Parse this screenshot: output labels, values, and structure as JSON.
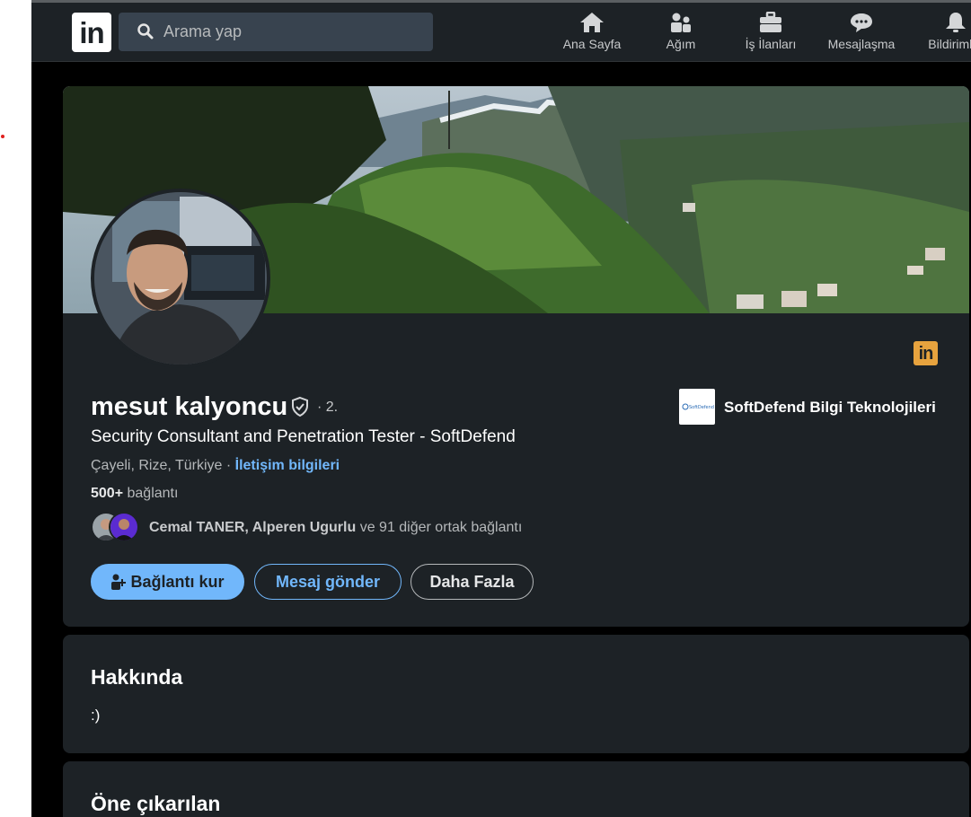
{
  "nav": {
    "logo_text": "in",
    "search_placeholder": "Arama yap",
    "items": [
      {
        "label": "Ana Sayfa",
        "icon": "home-icon"
      },
      {
        "label": "Ağım",
        "icon": "network-icon"
      },
      {
        "label": "İş İlanları",
        "icon": "briefcase-icon"
      },
      {
        "label": "Mesajlaşma",
        "icon": "messaging-icon"
      },
      {
        "label": "Bildirimler",
        "icon": "bell-icon"
      }
    ]
  },
  "profile": {
    "name": "mesut kalyoncu",
    "degree": "· 2.",
    "headline": "Security Consultant and Penetration Tester - SoftDefend",
    "location": "Çayeli, Rize, Türkiye",
    "location_separator": " · ",
    "contact_info": "İletişim bilgileri",
    "connections_count": "500+",
    "connections_label": " bağlantı",
    "mutual_names": "Cemal TANER, Alperen Ugurlu",
    "mutual_rest": " ve 91 diğer ortak bağlantı",
    "company": "SoftDefend Bilgi Teknolojileri",
    "company_logo_text": "SoftDefend",
    "li_badge_text": "in",
    "buttons": {
      "connect": "Bağlantı kur",
      "message": "Mesaj gönder",
      "more": "Daha Fazla"
    }
  },
  "about": {
    "title": "Hakkında",
    "text": ":)"
  },
  "featured": {
    "title": "Öne çıkarılan"
  },
  "colors": {
    "background": "#000000",
    "card": "#1d2226",
    "nav": "#1d2226",
    "accent": "#71b7fb",
    "premium_badge": "#e7a33e"
  }
}
